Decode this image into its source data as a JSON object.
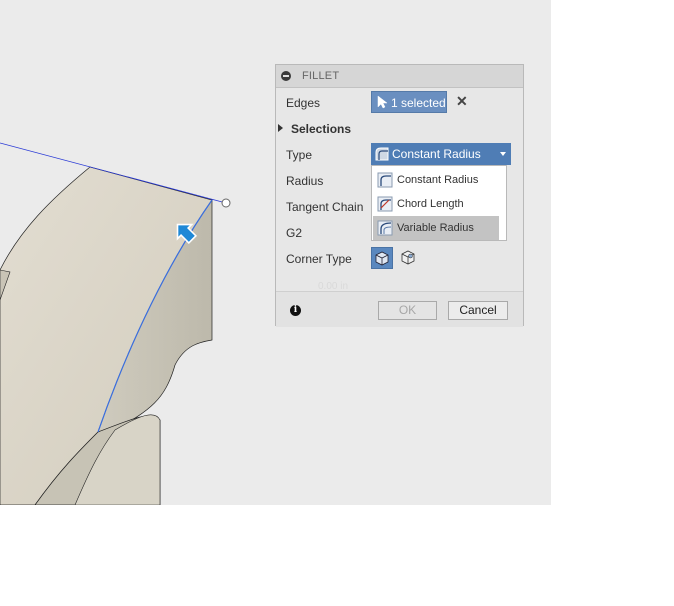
{
  "dialog": {
    "title": "FILLET",
    "edges": {
      "label": "Edges",
      "value": "1 selected"
    },
    "selections_label": "Selections",
    "type": {
      "label": "Type",
      "selected": "Constant Radius"
    },
    "type_options": [
      "Constant Radius",
      "Chord Length",
      "Variable Radius"
    ],
    "highlighted_option": "Variable Radius",
    "labels": {
      "radius": "Radius",
      "tangent_chain": "Tangent Chain",
      "g2": "G2",
      "corner_type": "Corner Type"
    },
    "faded_value": "0.00 in",
    "ok_label": "OK",
    "cancel_label": "Cancel"
  },
  "colors": {
    "accent": "#4f7db5",
    "selection_button": "#6a8fc0",
    "viewport_bg": "#ebebeb",
    "highlight": "#c3c3c3"
  },
  "icons": {
    "collapse": "collapse-icon",
    "cursor": "cursor-icon",
    "clear": "close-icon",
    "info": "info-icon"
  }
}
